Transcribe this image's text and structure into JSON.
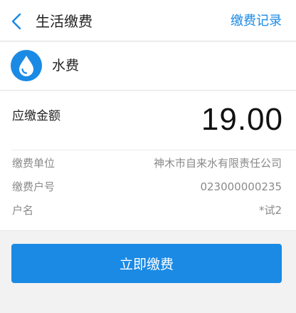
{
  "header": {
    "title": "生活缴费",
    "action_label": "缴费记录"
  },
  "provider": {
    "name": "水费",
    "icon": "water-drop-icon"
  },
  "bill": {
    "amount_label": "应缴金额",
    "amount_value": "19.00",
    "fields": [
      {
        "label": "缴费单位",
        "value": "神木市自来水有限责任公司"
      },
      {
        "label": "缴费户号",
        "value": "023000000235"
      },
      {
        "label": "户名",
        "value": "*试2"
      }
    ]
  },
  "actions": {
    "pay_label": "立即缴费"
  },
  "colors": {
    "accent": "#1a8ae5",
    "background": "#f2f2f2",
    "card": "#ffffff",
    "secondary_text": "#8a8a8a"
  }
}
